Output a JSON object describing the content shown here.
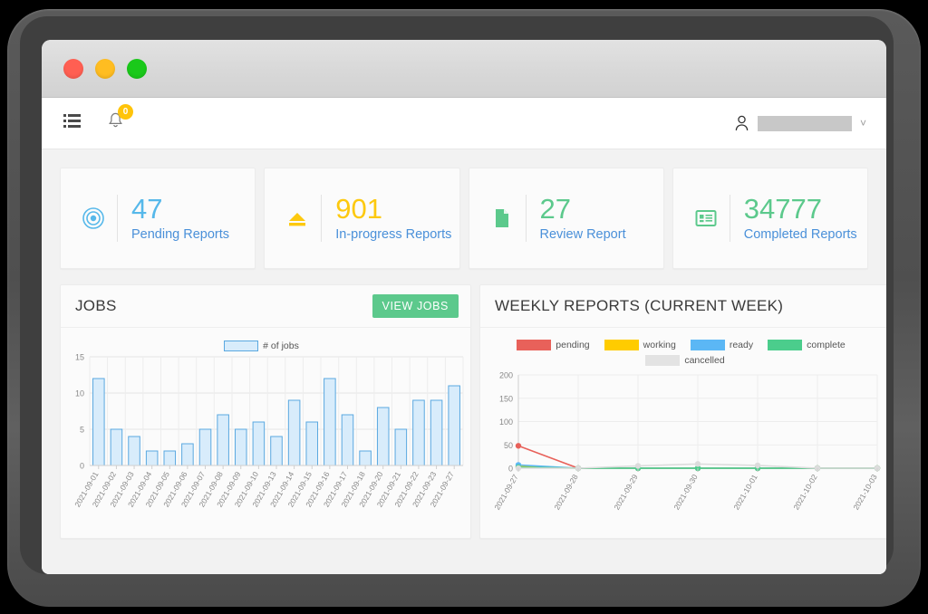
{
  "window": {
    "traffic_lights": [
      "close",
      "minimize",
      "maximize"
    ]
  },
  "topbar": {
    "menu_icon": "menu-list-icon",
    "bell_icon": "bell-icon",
    "notification_count": "0",
    "user_icon": "user-icon",
    "user_name": "",
    "chevron": "˅"
  },
  "cards": [
    {
      "icon": "target-circle-icon",
      "value": "47",
      "label": "Pending Reports",
      "color": "#56b8ea",
      "label_color": "#4a90d9"
    },
    {
      "icon": "eject-icon",
      "value": "901",
      "label": "In-progress Reports",
      "color": "#fdc90f",
      "label_color": "#4a90d9"
    },
    {
      "icon": "document-icon",
      "value": "27",
      "label": "Review Report",
      "color": "#5cc98c",
      "label_color": "#4a90d9"
    },
    {
      "icon": "list-card-icon",
      "value": "34777",
      "label": "Completed Reports",
      "color": "#5cc98c",
      "label_color": "#4a90d9"
    }
  ],
  "jobs_panel": {
    "title": "JOBS",
    "button_label": "VIEW JOBS"
  },
  "weekly_panel": {
    "title": "WEEKLY REPORTS (CURRENT WEEK)"
  },
  "chart_data": [
    {
      "type": "bar",
      "title": "JOBS",
      "legend": [
        "# of jobs"
      ],
      "legend_position": "top-center",
      "xlabel": "",
      "ylabel": "",
      "ylim": [
        0,
        15
      ],
      "yticks": [
        0,
        5,
        10,
        15
      ],
      "grid": true,
      "bar_fill": "#d8ecfb",
      "bar_stroke": "#5aa8e0",
      "categories": [
        "2021-09-01",
        "2021-09-02",
        "2021-09-03",
        "2021-09-04",
        "2021-09-05",
        "2021-09-06",
        "2021-09-07",
        "2021-09-08",
        "2021-09-09",
        "2021-09-10",
        "2021-09-13",
        "2021-09-14",
        "2021-09-15",
        "2021-09-16",
        "2021-09-17",
        "2021-09-18",
        "2021-09-20",
        "2021-09-21",
        "2021-09-22",
        "2021-09-23",
        "2021-09-27"
      ],
      "values": [
        12,
        5,
        4,
        2,
        2,
        3,
        5,
        7,
        5,
        6,
        4,
        9,
        6,
        12,
        7,
        2,
        8,
        5,
        9,
        9,
        11
      ]
    },
    {
      "type": "line",
      "title": "WEEKLY REPORTS (CURRENT WEEK)",
      "legend_position": "top-center",
      "xlabel": "",
      "ylabel": "",
      "ylim": [
        0,
        200
      ],
      "yticks": [
        0,
        50,
        100,
        150,
        200
      ],
      "grid": true,
      "x": [
        "2021-09-27",
        "2021-09-28",
        "2021-09-29",
        "2021-09-30",
        "2021-10-01",
        "2021-10-02",
        "2021-10-03"
      ],
      "series": [
        {
          "name": "pending",
          "color": "#e8615a",
          "values": [
            48,
            0,
            0,
            0,
            0,
            0,
            0
          ]
        },
        {
          "name": "working",
          "color": "#ffcc00",
          "values": [
            4,
            0,
            0,
            0,
            0,
            0,
            0
          ]
        },
        {
          "name": "ready",
          "color": "#5bb7f5",
          "values": [
            7,
            0,
            0,
            0,
            0,
            0,
            0
          ]
        },
        {
          "name": "complete",
          "color": "#4bcd8c",
          "values": [
            2,
            0,
            0,
            0,
            0,
            0,
            0
          ]
        },
        {
          "name": "cancelled",
          "color": "#dcdcdc",
          "values": [
            0,
            0,
            5,
            9,
            6,
            0,
            0
          ]
        }
      ]
    }
  ]
}
